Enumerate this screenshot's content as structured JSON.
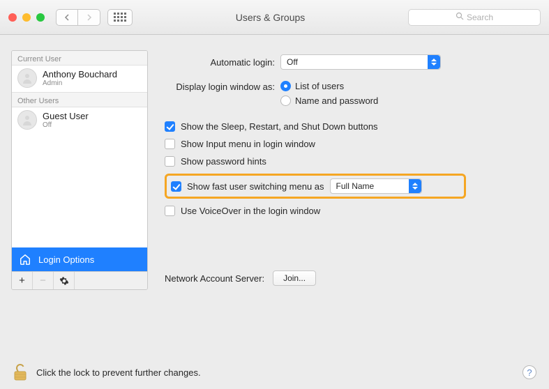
{
  "toolbar": {
    "title": "Users & Groups",
    "search_placeholder": "Search"
  },
  "sidebar": {
    "current_header": "Current User",
    "other_header": "Other Users",
    "current_user": {
      "name": "Anthony Bouchard",
      "role": "Admin"
    },
    "other_user": {
      "name": "Guest User",
      "role": "Off"
    },
    "login_options": "Login Options"
  },
  "settings": {
    "automatic_login_label": "Automatic login:",
    "automatic_login_value": "Off",
    "display_login_label": "Display login window as:",
    "radio_list": "List of users",
    "radio_namepw": "Name and password",
    "chk_sleep": "Show the Sleep, Restart, and Shut Down buttons",
    "chk_input": "Show Input menu in login window",
    "chk_hints": "Show password hints",
    "chk_fast": "Show fast user switching menu as",
    "fast_value": "Full Name",
    "chk_voiceover": "Use VoiceOver in the login window",
    "network_label": "Network Account Server:",
    "join_label": "Join..."
  },
  "footer": {
    "lock_text": "Click the lock to prevent further changes."
  }
}
